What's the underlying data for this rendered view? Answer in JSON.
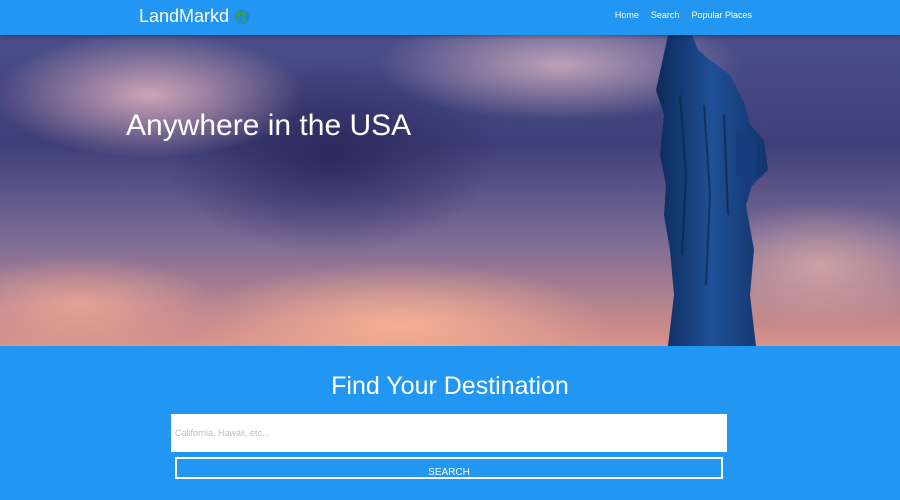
{
  "navbar": {
    "brand": "LandMarkd",
    "brand_icon": "globe-icon",
    "links": [
      "Home",
      "Search",
      "Popular Places"
    ]
  },
  "hero": {
    "title": "Anywhere in the USA"
  },
  "search": {
    "title": "Find Your Destination",
    "placeholder": "California, Hawaii, etc...",
    "button_label": "SEARCH"
  },
  "colors": {
    "primary": "#2196f3",
    "text": "#ffffff"
  }
}
